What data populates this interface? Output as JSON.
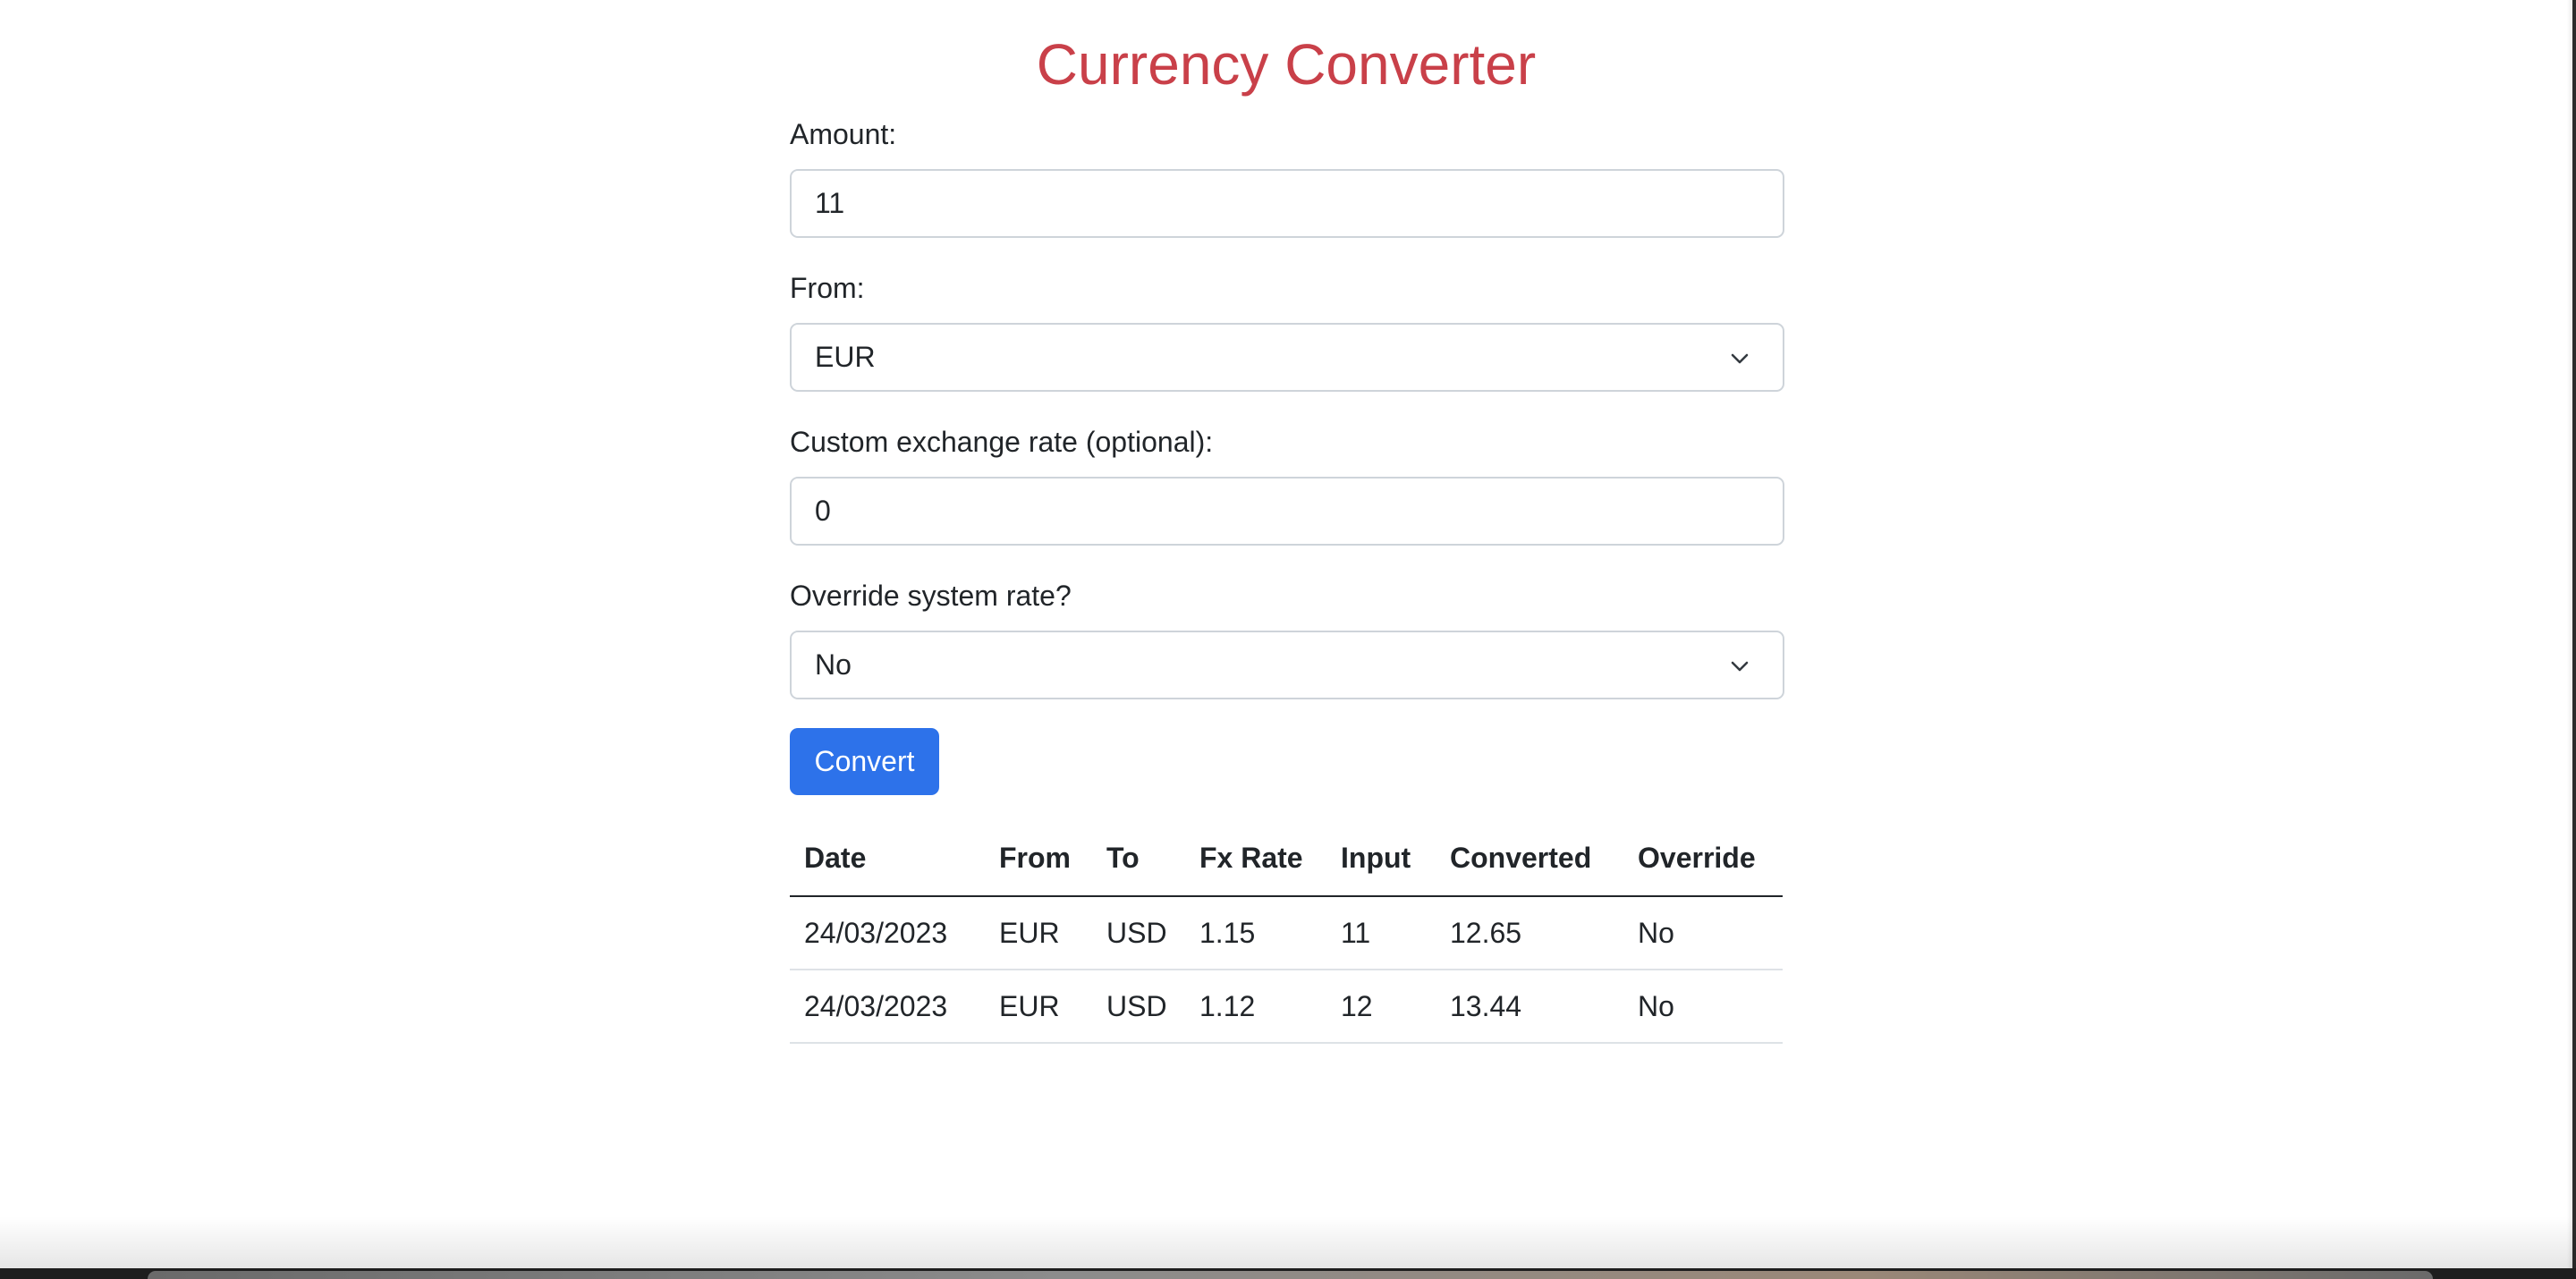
{
  "app": {
    "title": "Currency Converter"
  },
  "form": {
    "amount": {
      "label": "Amount:",
      "value": "11"
    },
    "from": {
      "label": "From:",
      "selected": "EUR"
    },
    "custom_rate": {
      "label": "Custom exchange rate (optional):",
      "value": "0"
    },
    "override": {
      "label": "Override system rate?",
      "selected": "No"
    },
    "convert_label": "Convert"
  },
  "table": {
    "headers": [
      "Date",
      "From",
      "To",
      "Fx Rate",
      "Input",
      "Converted",
      "Override"
    ],
    "rows": [
      [
        "24/03/2023",
        "EUR",
        "USD",
        "1.15",
        "11",
        "12.65",
        "No"
      ],
      [
        "24/03/2023",
        "EUR",
        "USD",
        "1.12",
        "12",
        "13.44",
        "No"
      ]
    ]
  },
  "icons": {
    "select_arrow": "chevron-down-icon"
  },
  "colors": {
    "title": "#c94049",
    "button": "#2d72ea",
    "input_border": "#ced4da"
  }
}
